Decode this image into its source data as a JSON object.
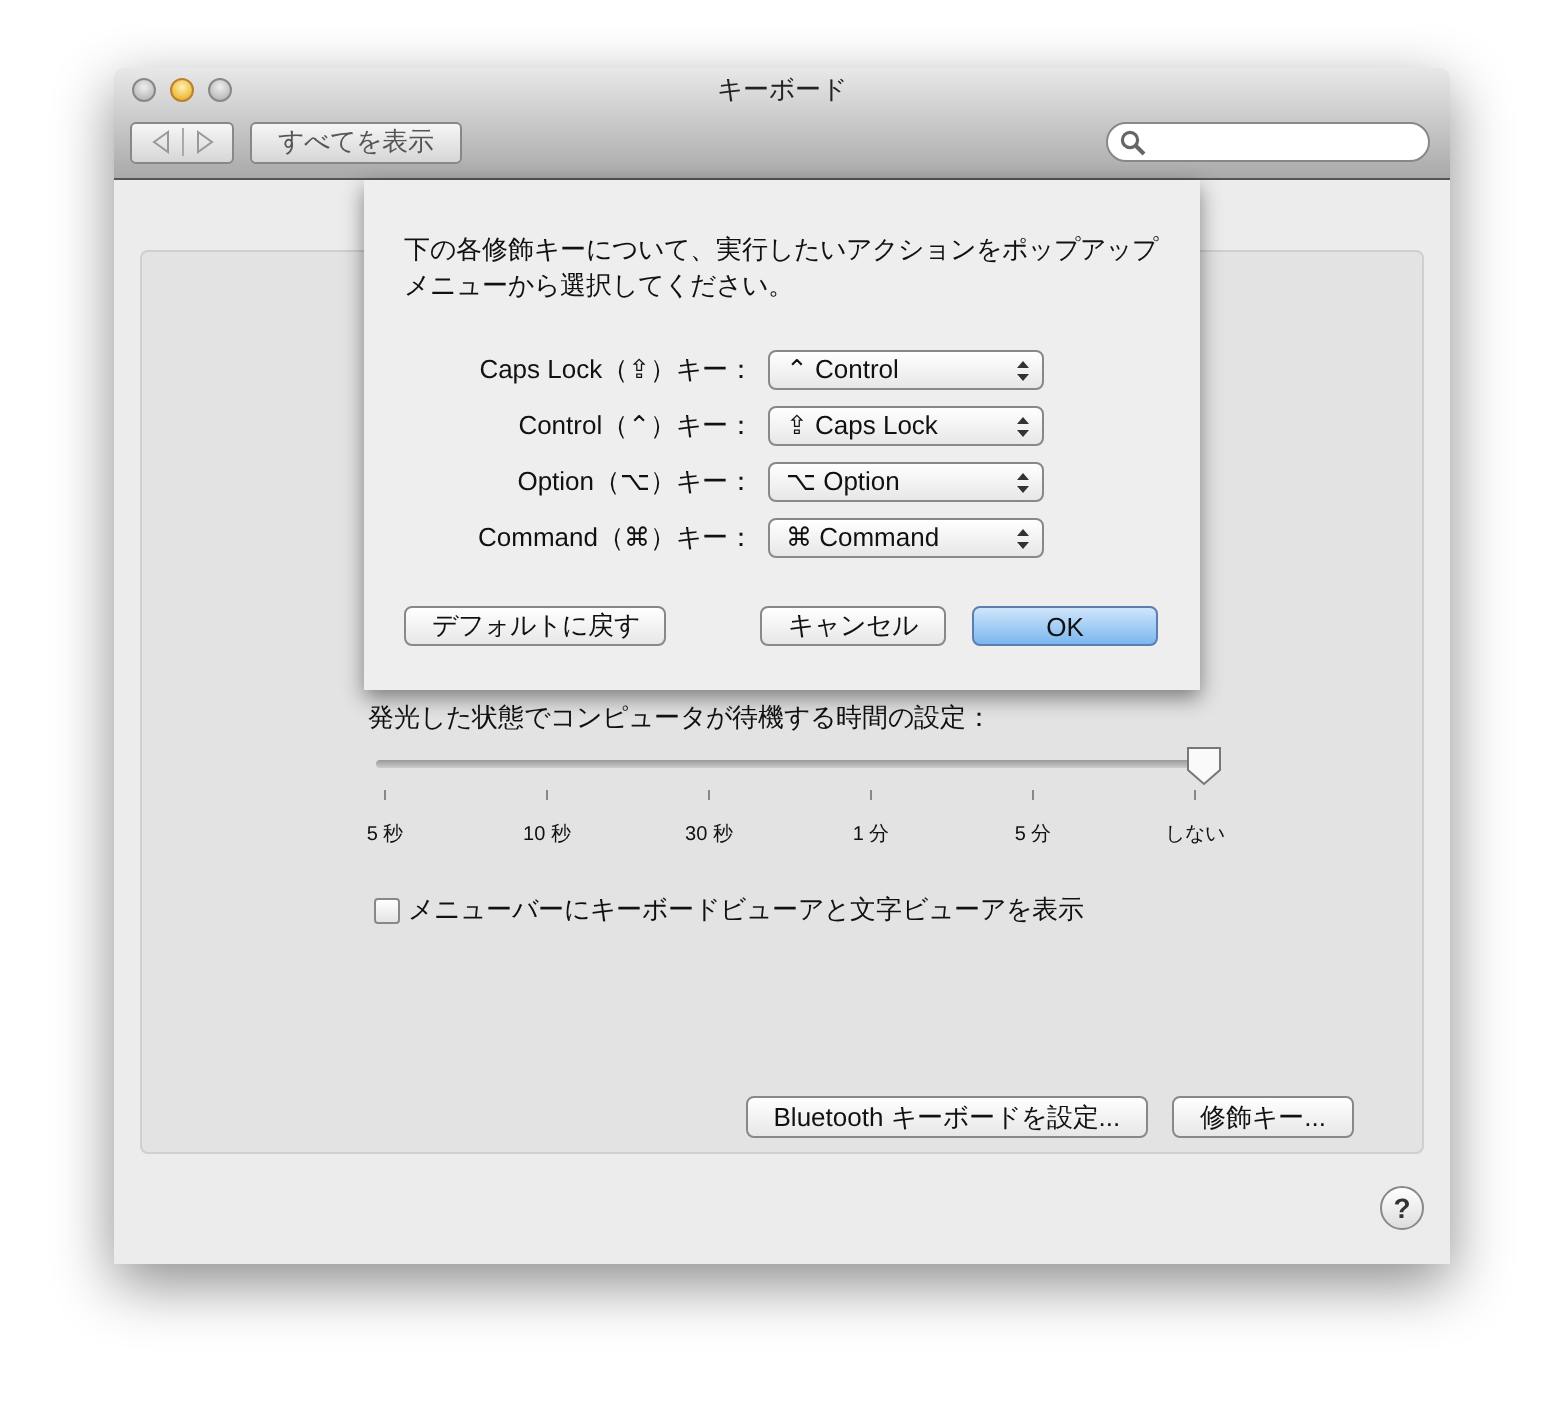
{
  "window": {
    "title": "キーボード"
  },
  "toolbar": {
    "show_all_button": "すべてを表示"
  },
  "panel": {
    "slider": {
      "label": "発光した状態でコンピュータが待機する時間の設定：",
      "level": 1,
      "ticks": [
        "5 秒",
        "10 秒",
        "30 秒",
        "1 分",
        "5 分",
        "しない"
      ]
    },
    "menu_bar_option": {
      "label": "メニューバーにキーボードビューアと文字ビューアを表示",
      "checked": false
    },
    "buttons": [
      "Bluetooth キーボードを設定...",
      "修飾キー..."
    ]
  },
  "help_button": "?",
  "sheet": {
    "message": "下の各修飾キーについて、実行したいアクションをポップアップメニューから選択してください。",
    "mappings": [
      {
        "key": "Caps Lock（⇪）キー：",
        "action": "⌃ Control"
      },
      {
        "key": "Control（⌃）キー：",
        "action": "⇪ Caps Lock"
      },
      {
        "key": "Option（⌥）キー：",
        "action": "⌥ Option"
      },
      {
        "key": "Command（⌘）キー：",
        "action": "⌘ Command"
      }
    ],
    "buttons": [
      {
        "label": "デフォルトに戻す",
        "kind": "normal"
      },
      {
        "label": "キャンセル",
        "kind": "normal"
      },
      {
        "label": "OK",
        "kind": "default"
      }
    ]
  }
}
